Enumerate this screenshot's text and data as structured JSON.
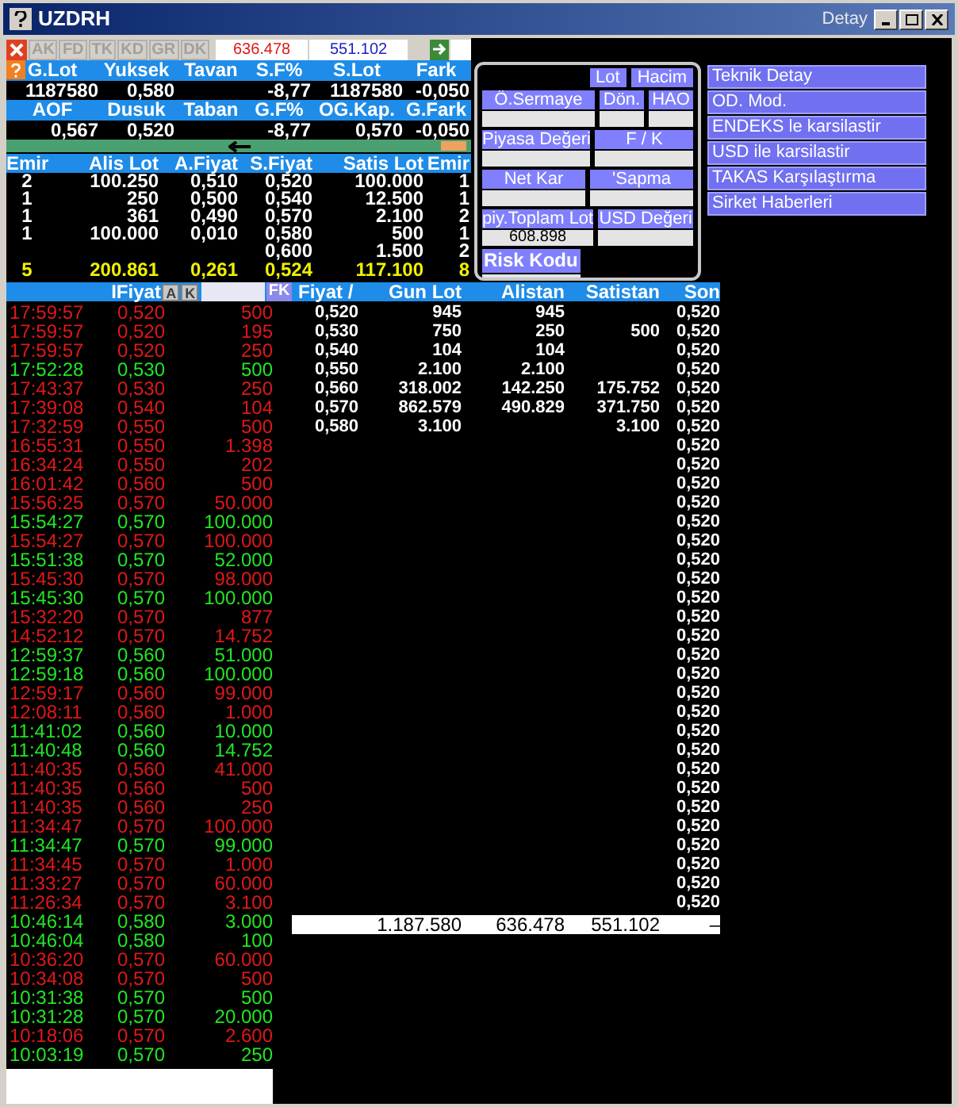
{
  "window": {
    "title": "UZDRH",
    "subtitle": "Detay"
  },
  "toolbar": {
    "buttons": [
      "AK",
      "FD",
      "TK",
      "KD",
      "GR",
      "DK"
    ],
    "buy_total": "636.478",
    "sell_total": "551.102"
  },
  "summary": [
    [
      {
        "header": "G.Lot",
        "value": "1187580"
      },
      {
        "header": "Yuksek",
        "value": "0,580"
      },
      {
        "header": "Tavan"
      },
      {
        "header": "S.F%",
        "value": "-8,77"
      },
      {
        "header": "S.Lot",
        "value": "1187580"
      },
      {
        "header": "Fark",
        "value": "-0,050"
      }
    ],
    [
      {
        "header": "AOF",
        "value": "0,567"
      },
      {
        "header": "Dusuk",
        "value": "0,520"
      },
      {
        "header": "Taban"
      },
      {
        "header": "G.F%",
        "value": "-8,77"
      },
      {
        "header": "OG.Kap.",
        "value": "0,570"
      },
      {
        "header": "G.Fark",
        "value": "-0,050"
      }
    ]
  ],
  "order_book": {
    "columns": [
      "Emir",
      "Alis Lot",
      "A.Fiyat",
      "S.Fiyat",
      "Satis Lot",
      "Emir"
    ],
    "rows": [
      {
        "buy_orders": "2",
        "buy_lot": "100.250",
        "buy_price": "0,510",
        "sell_price": "0,520",
        "sell_lot": "100.000",
        "sell_orders": "1"
      },
      {
        "buy_orders": "1",
        "buy_lot": "250",
        "buy_price": "0,500",
        "sell_price": "0,540",
        "sell_lot": "12.500",
        "sell_orders": "1"
      },
      {
        "buy_orders": "1",
        "buy_lot": "361",
        "buy_price": "0,490",
        "sell_price": "0,570",
        "sell_lot": "2.100",
        "sell_orders": "2"
      },
      {
        "buy_orders": "1",
        "buy_lot": "100.000",
        "buy_price": "0,010",
        "sell_price": "0,580",
        "sell_lot": "500",
        "sell_orders": "1"
      },
      {
        "sell_price": "0,600",
        "sell_lot": "1.500",
        "sell_orders": "2"
      }
    ],
    "totals": {
      "buy_orders": "5",
      "buy_lot": "200.861",
      "buy_price": "0,261",
      "sell_price": "0,524",
      "sell_lot": "117.100",
      "sell_orders": "8"
    }
  },
  "stats": {
    "toggles": [
      "Lot",
      "Hacim"
    ],
    "rows": [
      [
        {
          "label": "Ö.Sermaye"
        },
        {
          "label": "Dön."
        },
        {
          "label": "HAO"
        }
      ],
      [
        {
          "label": "Piyasa Değeri"
        },
        {
          "label": "F / K"
        }
      ],
      [
        {
          "label": "Net Kar"
        },
        {
          "label": "'Sapma"
        }
      ],
      [
        {
          "label": "piy.Toplam Lot",
          "value": "608.898"
        },
        {
          "label": "USD Değeri"
        }
      ]
    ],
    "risk_label": "Risk Kodu"
  },
  "menu": [
    "Teknik Detay",
    "OD. Mod.",
    "ENDEKS le karsilastir",
    "USD ile karsilastir",
    "TAKAS Karşılaştırma",
    "Sirket Haberleri"
  ],
  "trades": {
    "header": "IFiyat",
    "buttons": [
      "A",
      "K"
    ],
    "filter_button": "FK",
    "rows": [
      {
        "time": "17:59:57",
        "price": "0,520",
        "lot": "500",
        "kind": "sell"
      },
      {
        "time": "17:59:57",
        "price": "0,520",
        "lot": "195",
        "kind": "sell"
      },
      {
        "time": "17:59:57",
        "price": "0,520",
        "lot": "250",
        "kind": "sell"
      },
      {
        "time": "17:52:28",
        "price": "0,530",
        "lot": "500",
        "kind": "buy"
      },
      {
        "time": "17:43:37",
        "price": "0,530",
        "lot": "250",
        "kind": "sell"
      },
      {
        "time": "17:39:08",
        "price": "0,540",
        "lot": "104",
        "kind": "sell"
      },
      {
        "time": "17:32:59",
        "price": "0,550",
        "lot": "500",
        "kind": "sell"
      },
      {
        "time": "16:55:31",
        "price": "0,550",
        "lot": "1.398",
        "kind": "sell"
      },
      {
        "time": "16:34:24",
        "price": "0,550",
        "lot": "202",
        "kind": "sell"
      },
      {
        "time": "16:01:42",
        "price": "0,560",
        "lot": "500",
        "kind": "sell"
      },
      {
        "time": "15:56:25",
        "price": "0,570",
        "lot": "50.000",
        "kind": "sell"
      },
      {
        "time": "15:54:27",
        "price": "0,570",
        "lot": "100.000",
        "kind": "buy"
      },
      {
        "time": "15:54:27",
        "price": "0,570",
        "lot": "100.000",
        "kind": "sell"
      },
      {
        "time": "15:51:38",
        "price": "0,570",
        "lot": "52.000",
        "kind": "buy"
      },
      {
        "time": "15:45:30",
        "price": "0,570",
        "lot": "98.000",
        "kind": "sell"
      },
      {
        "time": "15:45:30",
        "price": "0,570",
        "lot": "100.000",
        "kind": "buy"
      },
      {
        "time": "15:32:20",
        "price": "0,570",
        "lot": "877",
        "kind": "sell"
      },
      {
        "time": "14:52:12",
        "price": "0,570",
        "lot": "14.752",
        "kind": "sell"
      },
      {
        "time": "12:59:37",
        "price": "0,560",
        "lot": "51.000",
        "kind": "buy"
      },
      {
        "time": "12:59:18",
        "price": "0,560",
        "lot": "100.000",
        "kind": "buy"
      },
      {
        "time": "12:59:17",
        "price": "0,560",
        "lot": "99.000",
        "kind": "sell"
      },
      {
        "time": "12:08:11",
        "price": "0,560",
        "lot": "1.000",
        "kind": "sell"
      },
      {
        "time": "11:41:02",
        "price": "0,560",
        "lot": "10.000",
        "kind": "buy"
      },
      {
        "time": "11:40:48",
        "price": "0,560",
        "lot": "14.752",
        "kind": "buy"
      },
      {
        "time": "11:40:35",
        "price": "0,560",
        "lot": "41.000",
        "kind": "sell"
      },
      {
        "time": "11:40:35",
        "price": "0,560",
        "lot": "500",
        "kind": "sell"
      },
      {
        "time": "11:40:35",
        "price": "0,560",
        "lot": "250",
        "kind": "sell"
      },
      {
        "time": "11:34:47",
        "price": "0,570",
        "lot": "100.000",
        "kind": "sell"
      },
      {
        "time": "11:34:47",
        "price": "0,570",
        "lot": "99.000",
        "kind": "buy"
      },
      {
        "time": "11:34:45",
        "price": "0,570",
        "lot": "1.000",
        "kind": "sell"
      },
      {
        "time": "11:33:27",
        "price": "0,570",
        "lot": "60.000",
        "kind": "sell"
      },
      {
        "time": "11:26:34",
        "price": "0,570",
        "lot": "3.100",
        "kind": "sell"
      },
      {
        "time": "10:46:14",
        "price": "0,580",
        "lot": "3.000",
        "kind": "buy"
      },
      {
        "time": "10:46:04",
        "price": "0,580",
        "lot": "100",
        "kind": "buy"
      },
      {
        "time": "10:36:20",
        "price": "0,570",
        "lot": "60.000",
        "kind": "sell"
      },
      {
        "time": "10:34:08",
        "price": "0,570",
        "lot": "500",
        "kind": "sell"
      },
      {
        "time": "10:31:38",
        "price": "0,570",
        "lot": "500",
        "kind": "buy"
      },
      {
        "time": "10:31:28",
        "price": "0,570",
        "lot": "20.000",
        "kind": "buy"
      },
      {
        "time": "10:18:06",
        "price": "0,570",
        "lot": "2.600",
        "kind": "sell"
      },
      {
        "time": "10:03:19",
        "price": "0,570",
        "lot": "250",
        "kind": "buy"
      }
    ]
  },
  "price_table": {
    "columns": [
      "Fiyat /",
      "Gun Lot",
      "Alistan",
      "Satistan",
      "Son"
    ],
    "rows": [
      {
        "price": "0,520",
        "day_lot": "945",
        "bought": "945",
        "last": "0,520"
      },
      {
        "price": "0,530",
        "day_lot": "750",
        "bought": "250",
        "sold": "500",
        "last": "0,520"
      },
      {
        "price": "0,540",
        "day_lot": "104",
        "bought": "104",
        "last": "0,520"
      },
      {
        "price": "0,550",
        "day_lot": "2.100",
        "bought": "2.100",
        "last": "0,520"
      },
      {
        "price": "0,560",
        "day_lot": "318.002",
        "bought": "142.250",
        "sold": "175.752",
        "last": "0,520"
      },
      {
        "price": "0,570",
        "day_lot": "862.579",
        "bought": "490.829",
        "sold": "371.750",
        "last": "0,520"
      },
      {
        "price": "0,580",
        "day_lot": "3.100",
        "sold": "3.100",
        "last": "0,520"
      },
      {
        "last": "0,520"
      },
      {
        "last": "0,520"
      },
      {
        "last": "0,520"
      },
      {
        "last": "0,520"
      },
      {
        "last": "0,520"
      },
      {
        "last": "0,520"
      },
      {
        "last": "0,520"
      },
      {
        "last": "0,520"
      },
      {
        "last": "0,520"
      },
      {
        "last": "0,520"
      },
      {
        "last": "0,520"
      },
      {
        "last": "0,520"
      },
      {
        "last": "0,520"
      },
      {
        "last": "0,520"
      },
      {
        "last": "0,520"
      },
      {
        "last": "0,520"
      },
      {
        "last": "0,520"
      },
      {
        "last": "0,520"
      },
      {
        "last": "0,520"
      },
      {
        "last": "0,520"
      },
      {
        "last": "0,520"
      },
      {
        "last": "0,520"
      },
      {
        "last": "0,520"
      },
      {
        "last": "0,520"
      },
      {
        "last": "0,520"
      }
    ],
    "totals": {
      "day_lot": "1.187.580",
      "bought": "636.478",
      "sold": "551.102",
      "last": "–"
    }
  }
}
